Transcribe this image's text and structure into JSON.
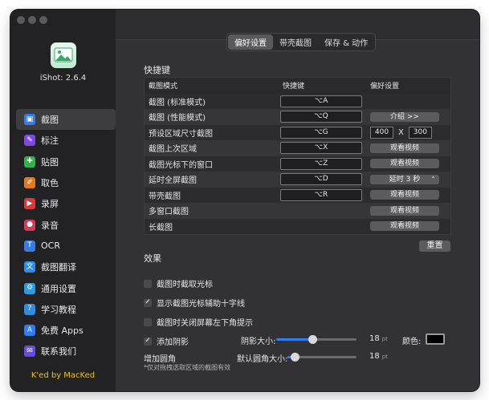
{
  "app": {
    "name": "iShot: 2.6.4",
    "footer": "K'ed by MacKed"
  },
  "sidebar": {
    "items": [
      {
        "label": "截图",
        "icon": "screenshot-icon",
        "color": "#3a7be0",
        "glyph": "▣",
        "active": true
      },
      {
        "label": "标注",
        "icon": "annotate-icon",
        "color": "#7b4be0",
        "glyph": "✎"
      },
      {
        "label": "贴图",
        "icon": "pin-icon",
        "color": "#32b34a",
        "glyph": "✚"
      },
      {
        "label": "取色",
        "icon": "color-picker-icon",
        "color": "#e07b1f",
        "glyph": "✐"
      },
      {
        "label": "录屏",
        "icon": "record-screen-icon",
        "color": "#d63a3a",
        "glyph": "▶"
      },
      {
        "label": "录音",
        "icon": "record-audio-icon",
        "color": "#d63a5a",
        "glyph": "●"
      },
      {
        "label": "OCR",
        "icon": "ocr-icon",
        "color": "#3a7be0",
        "glyph": "T"
      },
      {
        "label": "截图翻译",
        "icon": "translate-icon",
        "color": "#2e8de0",
        "glyph": "文"
      },
      {
        "label": "通用设置",
        "icon": "settings-icon",
        "color": "#2e9be0",
        "glyph": "⚙"
      },
      {
        "label": "学习教程",
        "icon": "tutorial-icon",
        "color": "#2e8de0",
        "glyph": "?"
      },
      {
        "label": "免费 Apps",
        "icon": "appstore-icon",
        "color": "#2f7cf6",
        "glyph": "A"
      },
      {
        "label": "联系我们",
        "icon": "contact-icon",
        "color": "#6a4be0",
        "glyph": "✉"
      }
    ]
  },
  "tabs": [
    {
      "label": "偏好设置",
      "active": true
    },
    {
      "label": "带壳截图"
    },
    {
      "label": "保存 & 动作"
    }
  ],
  "shortcuts": {
    "title": "快捷键",
    "columns": [
      "截图模式",
      "快捷键",
      "偏好设置"
    ],
    "rows": [
      {
        "mode": "截图 (标准模式)",
        "key": "⌥A",
        "pref": ""
      },
      {
        "mode": "截图 (性能模式)",
        "key": "⌥Q",
        "pref": "介绍  >>"
      },
      {
        "mode": "预设区域尺寸截图",
        "key": "⌥G",
        "pref_w": "400",
        "pref_x": "X",
        "pref_h": "300"
      },
      {
        "mode": "截图上次区域",
        "key": "⌥X",
        "pref": "观看视频"
      },
      {
        "mode": "截图光标下的窗口",
        "key": "⌥Z",
        "pref": "观看视频"
      },
      {
        "mode": "延时全屏截图",
        "key": "⌥D",
        "pref": "延时 3 秒",
        "select": true
      },
      {
        "mode": "带壳截图",
        "key": "⌥R",
        "pref": "观看视频"
      },
      {
        "mode": "多窗口截图",
        "key": "",
        "pref": "观看视频"
      },
      {
        "mode": "长截图",
        "key": "",
        "pref": "观看视频"
      }
    ],
    "reset": "重置"
  },
  "effects": {
    "title": "效果",
    "options": [
      {
        "label": "截图时截取光标",
        "checked": false
      },
      {
        "label": "显示截图光标辅助十字线",
        "checked": true
      },
      {
        "label": "截图时关闭屏幕左下角提示",
        "checked": false
      },
      {
        "label": "添加阴影",
        "checked": true
      }
    ],
    "shadow_label": "阴影大小:",
    "shadow_value": "18",
    "shadow_level": 0.45,
    "unit": "pt",
    "color_label": "颜色:",
    "shadow_color": "#000000",
    "corner_title": "增加圆角",
    "corner_label": "默认圆角大小:",
    "corner_value": "18",
    "corner_level": 0.1,
    "corner_note": "*仅对拖拽选取区域的截图有效"
  }
}
